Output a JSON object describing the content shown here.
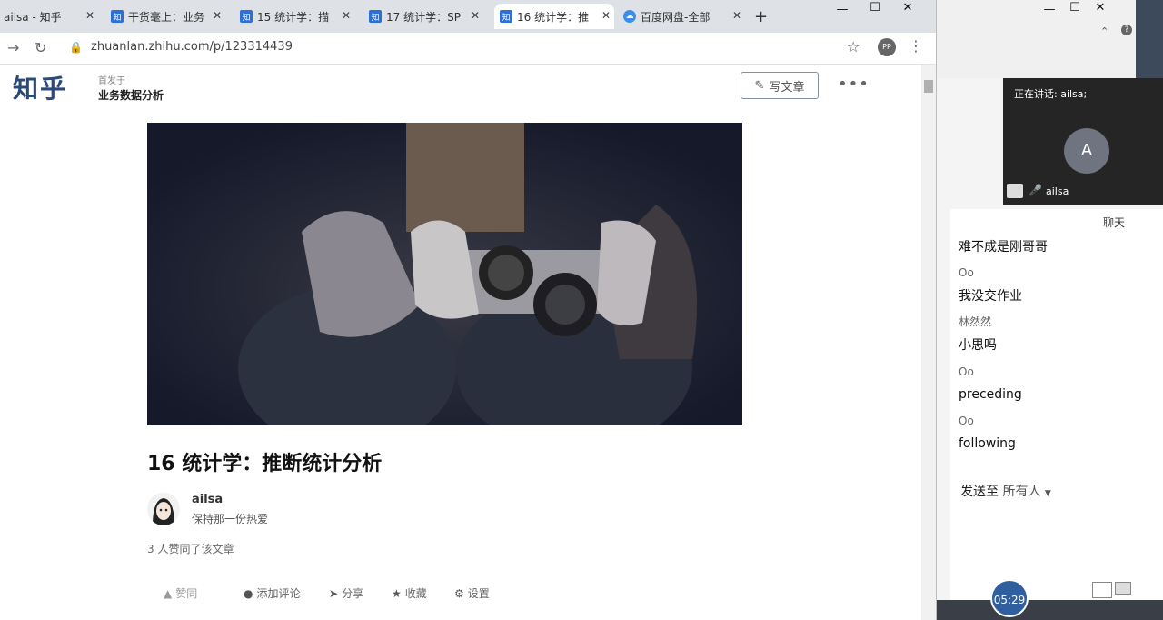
{
  "browser": {
    "tabs": [
      {
        "label": "ailsa - 知乎",
        "active": false
      },
      {
        "label": "干货毫上：业务",
        "active": false
      },
      {
        "label": "15 统计学：描",
        "active": false
      },
      {
        "label": "17 统计学：SP",
        "active": false
      },
      {
        "label": "16 统计学：推",
        "active": true
      },
      {
        "label": "百度网盘-全部",
        "active": false
      }
    ],
    "new_tab": "+",
    "window_controls": {
      "minimize": "—",
      "maximize": "☐",
      "close": "✕"
    },
    "url": "zhuanlan.zhihu.com/p/123314439",
    "profile_initials": "PP"
  },
  "zhihu_header": {
    "logo": "知乎",
    "column_sub": "首发于",
    "column_name": "业务数据分析",
    "write_button": "写文章",
    "more": "•••"
  },
  "article": {
    "title": "16 统计学：推断统计分析",
    "author_name": "ailsa",
    "author_bio": "保持那一份热爱",
    "likes": "3 人赞同了该文章",
    "actions": {
      "upvote": "赞同",
      "comment": "添加评论",
      "share": "分享",
      "favorite": "收藏",
      "settings": "设置"
    }
  },
  "meeting": {
    "window_controls": {
      "minimize": "—",
      "maximize": "☐",
      "close": "✕"
    },
    "speaking": "正在讲话: ailsa;",
    "video_avatar_letter": "A",
    "video_user": "ailsa",
    "chat_title": "聊天",
    "messages": [
      {
        "type": "text",
        "value": "难不成是刚哥哥"
      },
      {
        "type": "sender",
        "value": "Oo"
      },
      {
        "type": "text",
        "value": "我没交作业"
      },
      {
        "type": "sender",
        "value": "林然然"
      },
      {
        "type": "text",
        "value": "小思吗"
      },
      {
        "type": "sender",
        "value": "Oo"
      },
      {
        "type": "text",
        "value": "preceding"
      },
      {
        "type": "sender",
        "value": "Oo"
      },
      {
        "type": "text",
        "value": "following"
      }
    ],
    "send_to_label": "发送至",
    "send_to_target": "所有人",
    "timer": "05:29"
  }
}
